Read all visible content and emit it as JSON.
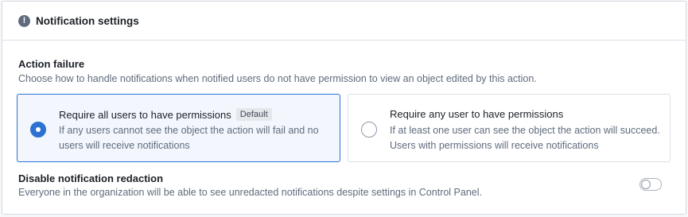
{
  "header": {
    "icon": "warning-sign-icon",
    "title": "Notification settings"
  },
  "action_failure": {
    "title": "Action failure",
    "description": "Choose how to handle notifications when notified users do not have permission to view an object edited by this action.",
    "options": [
      {
        "label": "Require all users to have permissions",
        "badge": "Default",
        "description": "If any users cannot see the object the action will fail and no users will receive notifications",
        "selected": true
      },
      {
        "label": "Require any user to have permissions",
        "description": "If at least one user can see the object the action will succeed. Users with permissions will receive notifications",
        "selected": false
      }
    ]
  },
  "redaction": {
    "title": "Disable notification redaction",
    "description": "Everyone in the organization will be able to see unredacted notifications despite settings in Control Panel.",
    "enabled": false
  },
  "colors": {
    "accent": "#2d72d2",
    "selected_bg": "#f3f7fd",
    "muted_text": "#5f6b7c"
  }
}
